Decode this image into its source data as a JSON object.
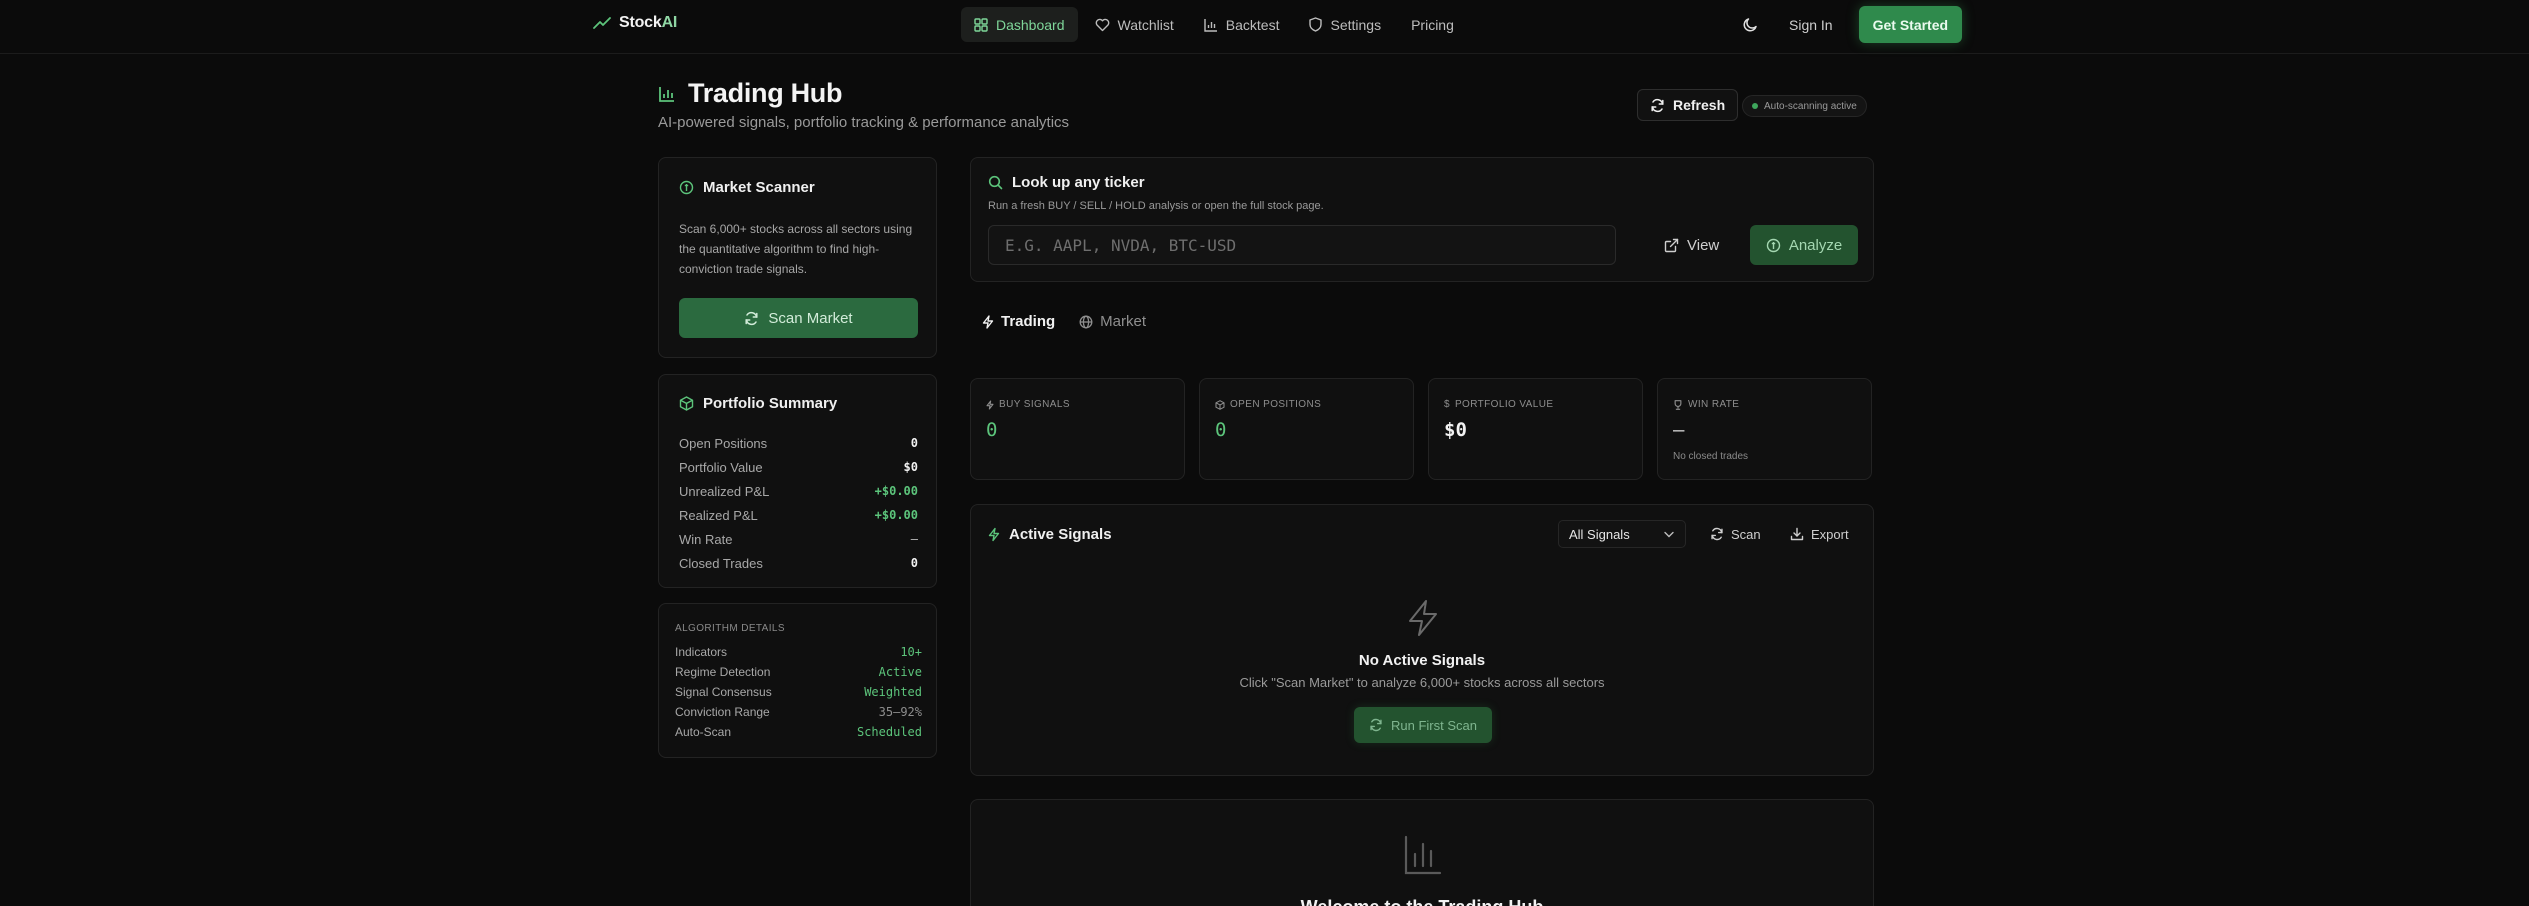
{
  "nav": {
    "brand_prefix": "Stock",
    "brand_suffix": "AI",
    "links": [
      {
        "label": "Dashboard",
        "icon": "grid-icon",
        "active": true
      },
      {
        "label": "Watchlist",
        "icon": "heart-icon"
      },
      {
        "label": "Backtest",
        "icon": "bar-chart-icon"
      },
      {
        "label": "Settings",
        "icon": "shield-icon"
      },
      {
        "label": "Pricing"
      }
    ],
    "sign_in": "Sign In",
    "get_started": "Get Started"
  },
  "header": {
    "title": "Trading Hub",
    "subtitle": "AI-powered signals, portfolio tracking & performance analytics",
    "refresh": "Refresh",
    "autoscan": "Auto-scanning active"
  },
  "scanner": {
    "title": "Market Scanner",
    "description": "Scan 6,000+ stocks across all sectors using the quantitative algorithm to find high-conviction trade signals.",
    "button": "Scan Market"
  },
  "portfolio": {
    "title": "Portfolio Summary",
    "rows": [
      {
        "label": "Open Positions",
        "value": "0"
      },
      {
        "label": "Portfolio Value",
        "value": "$0"
      },
      {
        "label": "Unrealized P&L",
        "value": "+$0.00"
      },
      {
        "label": "Realized P&L",
        "value": "+$0.00"
      },
      {
        "label": "Win Rate",
        "value": "—"
      },
      {
        "label": "Closed Trades",
        "value": "0"
      }
    ]
  },
  "algorithm": {
    "heading": "ALGORITHM DETAILS",
    "rows": [
      {
        "label": "Indicators",
        "value": "10+"
      },
      {
        "label": "Regime Detection",
        "value": "Active"
      },
      {
        "label": "Signal Consensus",
        "value": "Weighted"
      },
      {
        "label": "Conviction Range",
        "value": "35–92%"
      },
      {
        "label": "Auto-Scan",
        "value": "Scheduled"
      }
    ]
  },
  "lookup": {
    "title": "Look up any ticker",
    "subtitle": "Run a fresh BUY / SELL / HOLD analysis or open the full stock page.",
    "placeholder": "E.G. AAPL, NVDA, BTC-USD",
    "view": "View",
    "analyze": "Analyze"
  },
  "tabs": [
    {
      "label": "Trading",
      "active": true
    },
    {
      "label": "Market"
    }
  ],
  "stats": [
    {
      "label": "BUY SIGNALS",
      "value": "0"
    },
    {
      "label": "OPEN POSITIONS",
      "value": "0"
    },
    {
      "label": "PORTFOLIO VALUE",
      "value": "$0"
    },
    {
      "label": "WIN RATE",
      "value": "—",
      "note": "No closed trades"
    }
  ],
  "signals": {
    "title": "Active Signals",
    "filter": "All Signals",
    "scan": "Scan",
    "export": "Export",
    "empty_title": "No Active Signals",
    "empty_desc": "Click \"Scan Market\" to analyze 6,000+ stocks across all sectors",
    "run_button": "Run First Scan"
  },
  "welcome": {
    "title": "Welcome to the Trading Hub"
  },
  "colors": {
    "accent": "#2f8a4c",
    "accent_text": "#5cc47b",
    "background": "#0b0b0b",
    "card": "#101010"
  }
}
